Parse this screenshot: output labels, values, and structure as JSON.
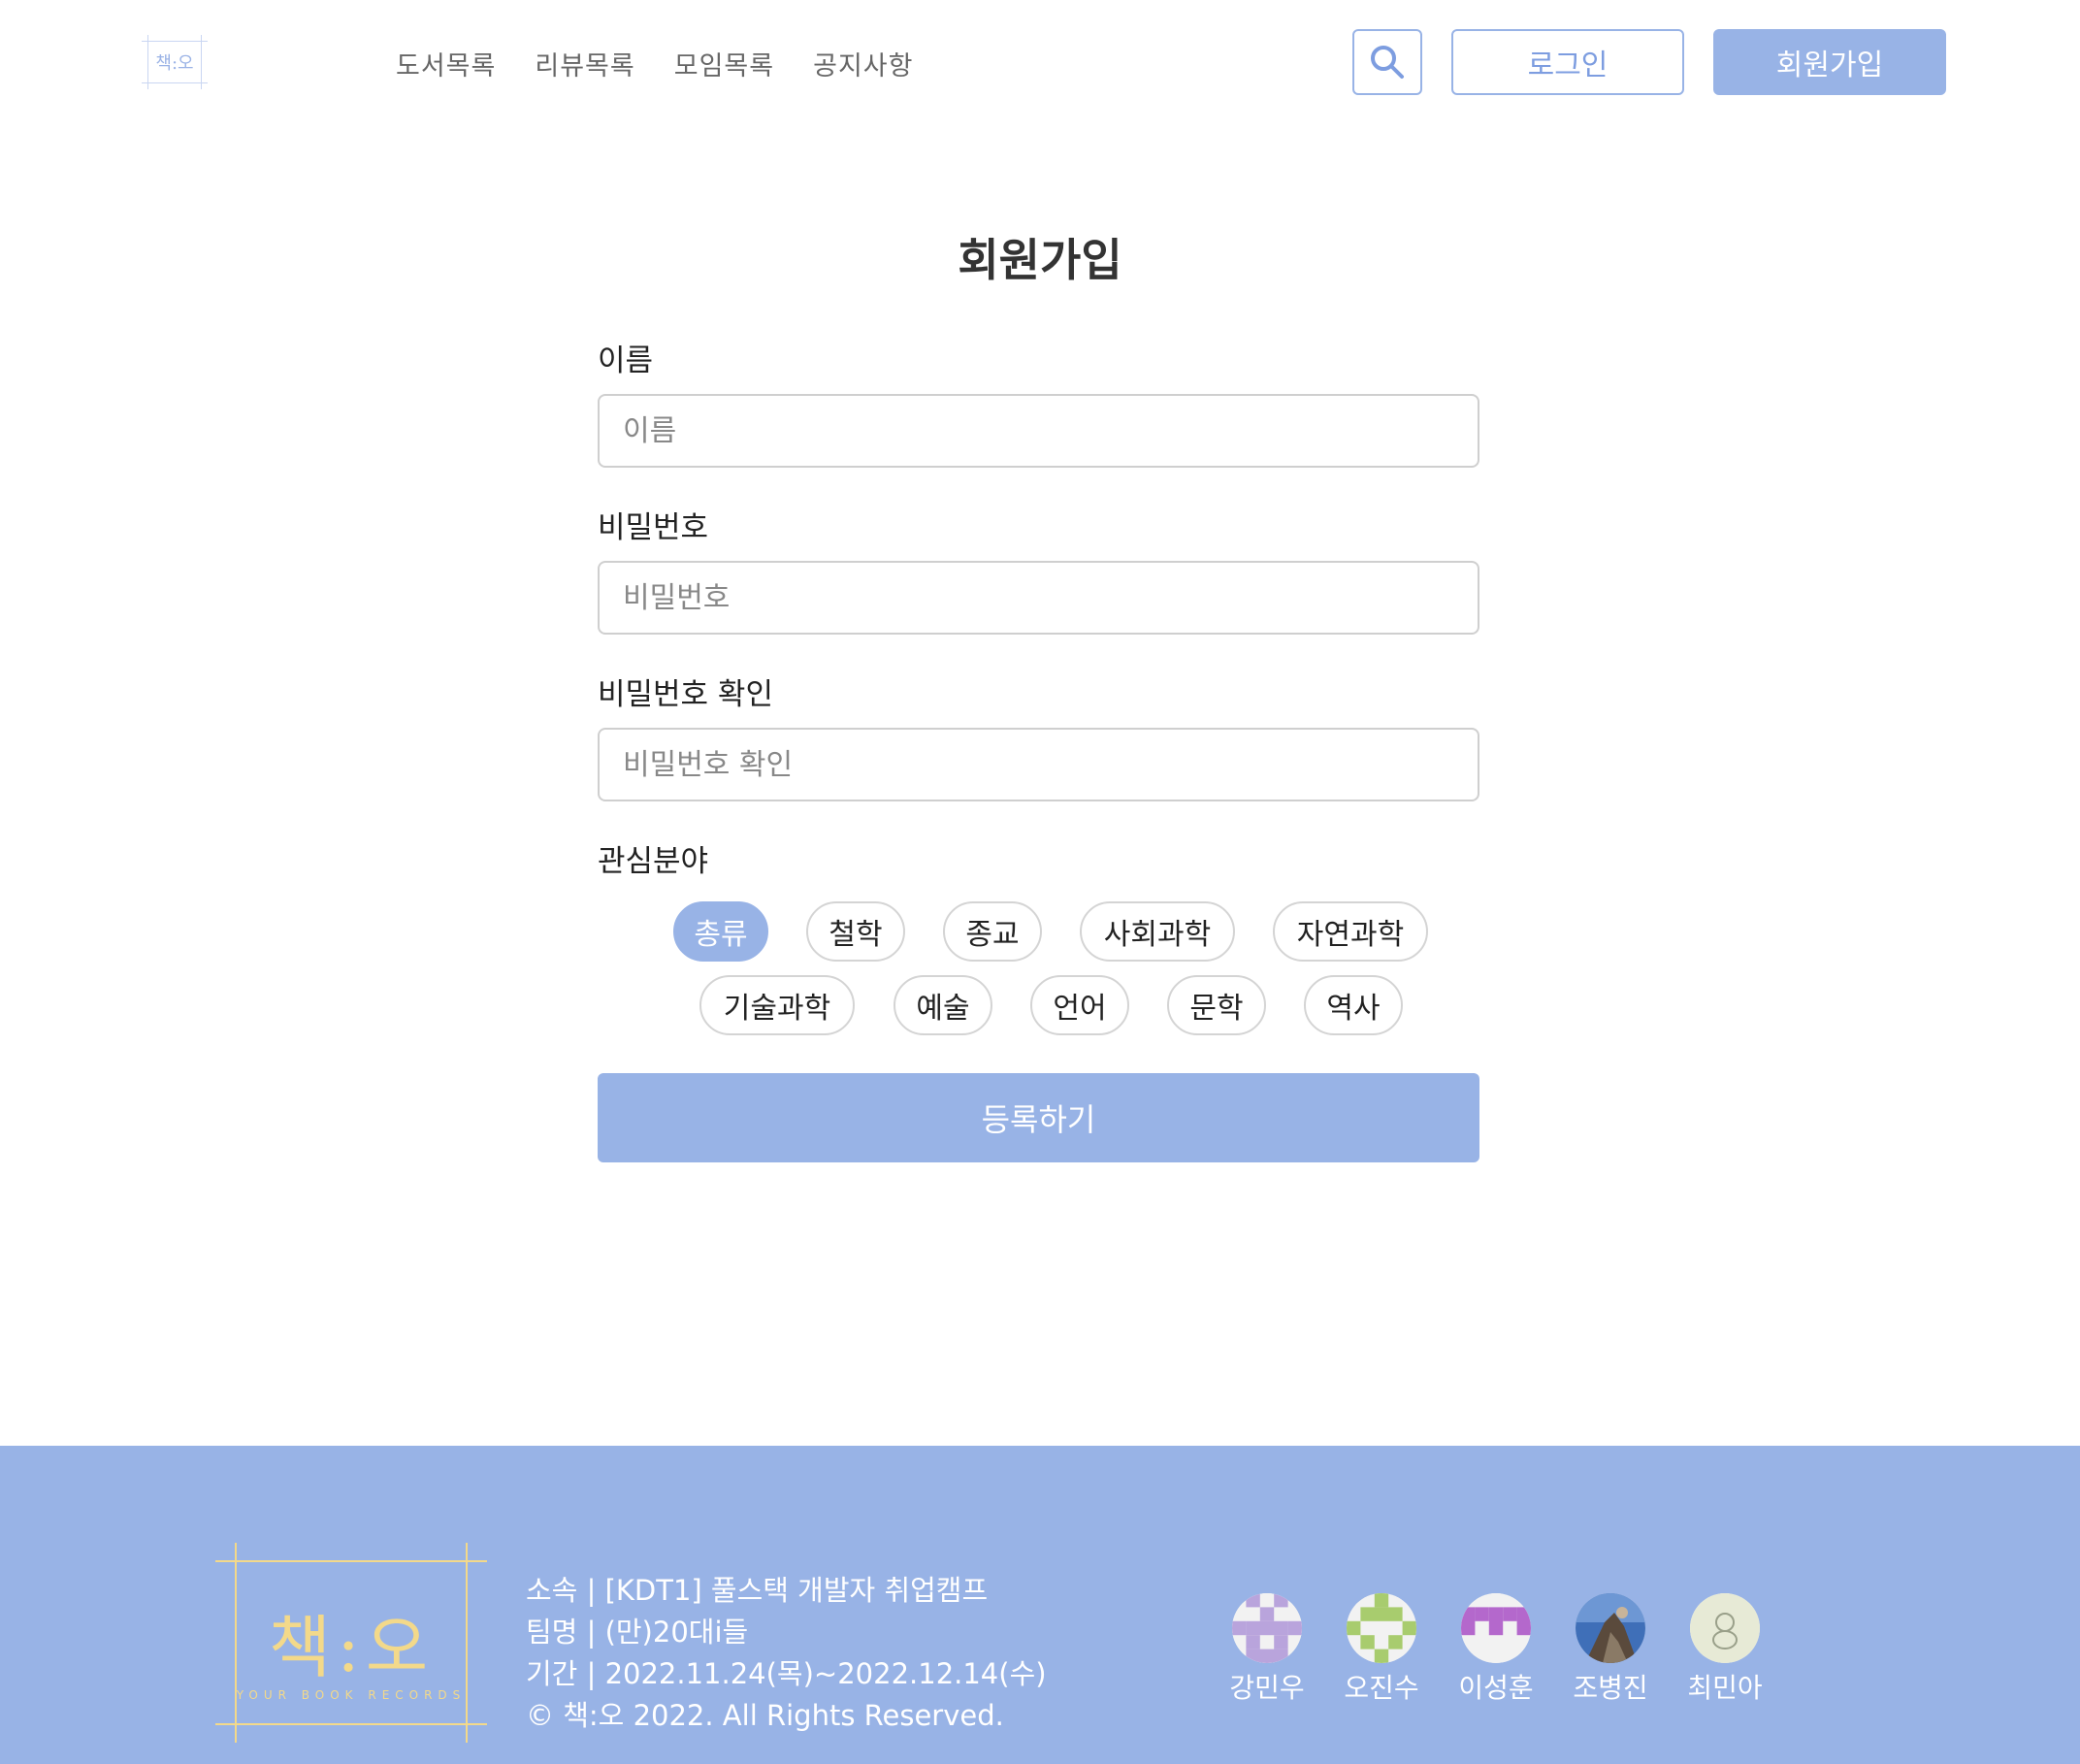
{
  "header": {
    "logo_text": "책:오",
    "nav": [
      "도서목록",
      "리뷰목록",
      "모임목록",
      "공지사항"
    ],
    "login_label": "로그인",
    "signup_label": "회원가입"
  },
  "form": {
    "title": "회원가입",
    "fields": [
      {
        "label": "이름",
        "placeholder": "이름"
      },
      {
        "label": "비밀번호",
        "placeholder": "비밀번호"
      },
      {
        "label": "비밀번호 확인",
        "placeholder": "비밀번호 확인"
      }
    ],
    "interest_label": "관심분야",
    "interests": [
      "총류",
      "철학",
      "종교",
      "사회과학",
      "자연과학",
      "기술과학",
      "예술",
      "언어",
      "문학",
      "역사"
    ],
    "selected_interest": "총류",
    "submit_label": "등록하기"
  },
  "footer": {
    "logo_text": "책:오",
    "logo_tagline": "YOUR BOOK RECORDS",
    "lines": [
      "소속 | [KDT1] 풀스택 개발자 취업캠프",
      "팀명 | (만)20대i들",
      "기간 | 2022.11.24(목)~2022.12.14(수)",
      "© 책:오 2022. All Rights Reserved."
    ],
    "members": [
      "강민우",
      "오진수",
      "이성훈",
      "조병진",
      "최민아"
    ]
  },
  "colors": {
    "accent": "#98b3e6",
    "logo_gold": "#f3d98a",
    "avatar_purple": "#b9a4dc",
    "avatar_green": "#a8cc6e",
    "avatar_magenta": "#b468cc"
  }
}
